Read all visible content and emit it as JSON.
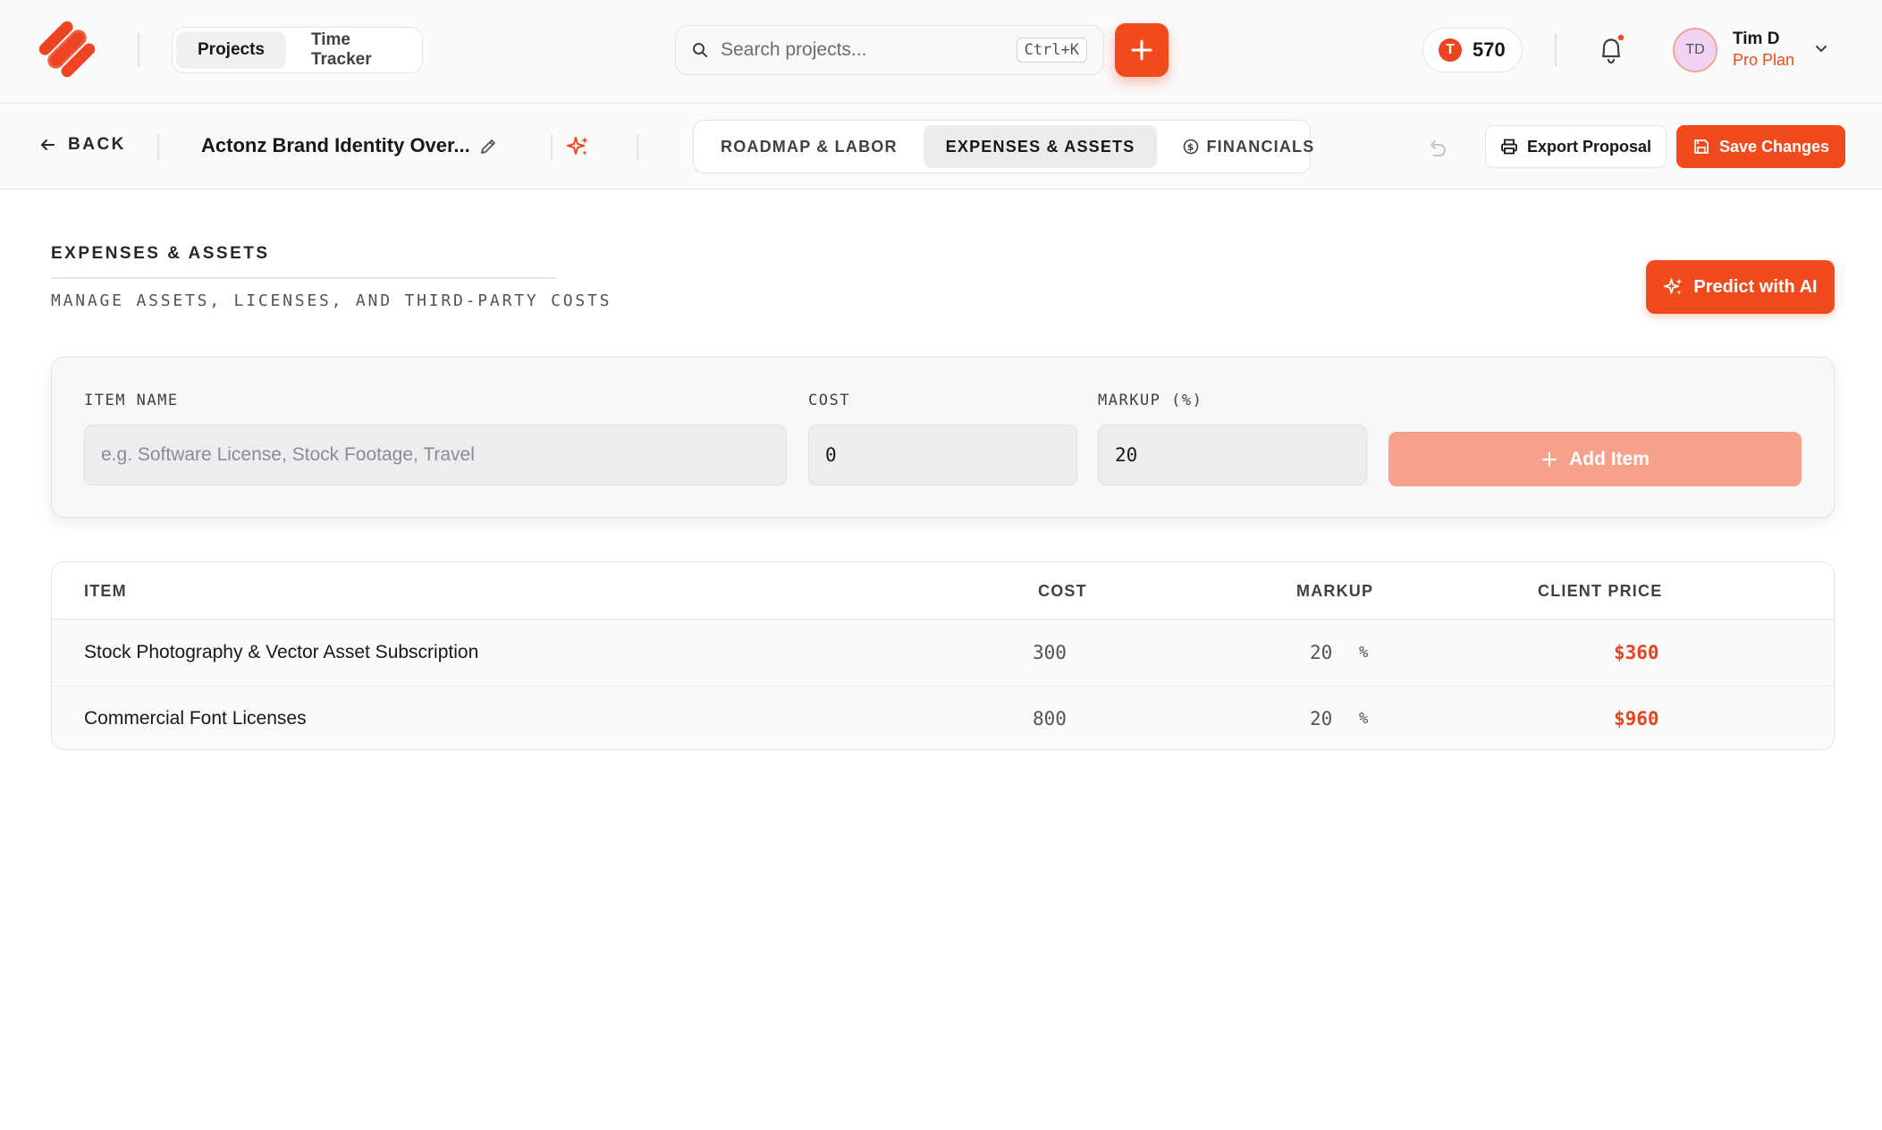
{
  "header": {
    "nav": {
      "projects": "Projects",
      "time_tracker": "Time Tracker"
    },
    "search": {
      "placeholder": "Search projects...",
      "shortcut": "Ctrl+K"
    },
    "credits": {
      "badge": "T",
      "value": "570"
    },
    "user": {
      "initials": "TD",
      "name": "Tim D",
      "plan": "Pro Plan"
    }
  },
  "subheader": {
    "back_label": "BACK",
    "project_title": "Actonz Brand Identity Over...",
    "tabs": [
      {
        "label": "ROADMAP & LABOR",
        "active": false
      },
      {
        "label": "EXPENSES & ASSETS",
        "active": true
      },
      {
        "label": "FINANCIALS",
        "active": false
      }
    ],
    "export_label": "Export Proposal",
    "save_label": "Save Changes"
  },
  "section": {
    "title": "EXPENSES & ASSETS",
    "subtitle": "MANAGE ASSETS, LICENSES, AND THIRD-PARTY COSTS",
    "predict_label": "Predict with AI"
  },
  "form": {
    "item_name_label": "ITEM NAME",
    "item_name_placeholder": "e.g. Software License, Stock Footage, Travel",
    "cost_label": "COST",
    "cost_value": "0",
    "markup_label": "MARKUP (%)",
    "markup_value": "20",
    "add_label": "Add Item"
  },
  "table": {
    "headers": {
      "item": "ITEM",
      "cost": "COST",
      "markup": "MARKUP",
      "client_price": "CLIENT PRICE"
    },
    "rows": [
      {
        "item": "Stock Photography & Vector Asset Subscription",
        "cost": "300",
        "markup": "20",
        "unit": "%",
        "client_price": "$360"
      },
      {
        "item": "Commercial Font Licenses",
        "cost": "800",
        "markup": "20",
        "unit": "%",
        "client_price": "$960"
      }
    ]
  },
  "colors": {
    "accent": "#f14a1c",
    "accent_muted": "#f7a18d",
    "price": "#e8431f"
  }
}
